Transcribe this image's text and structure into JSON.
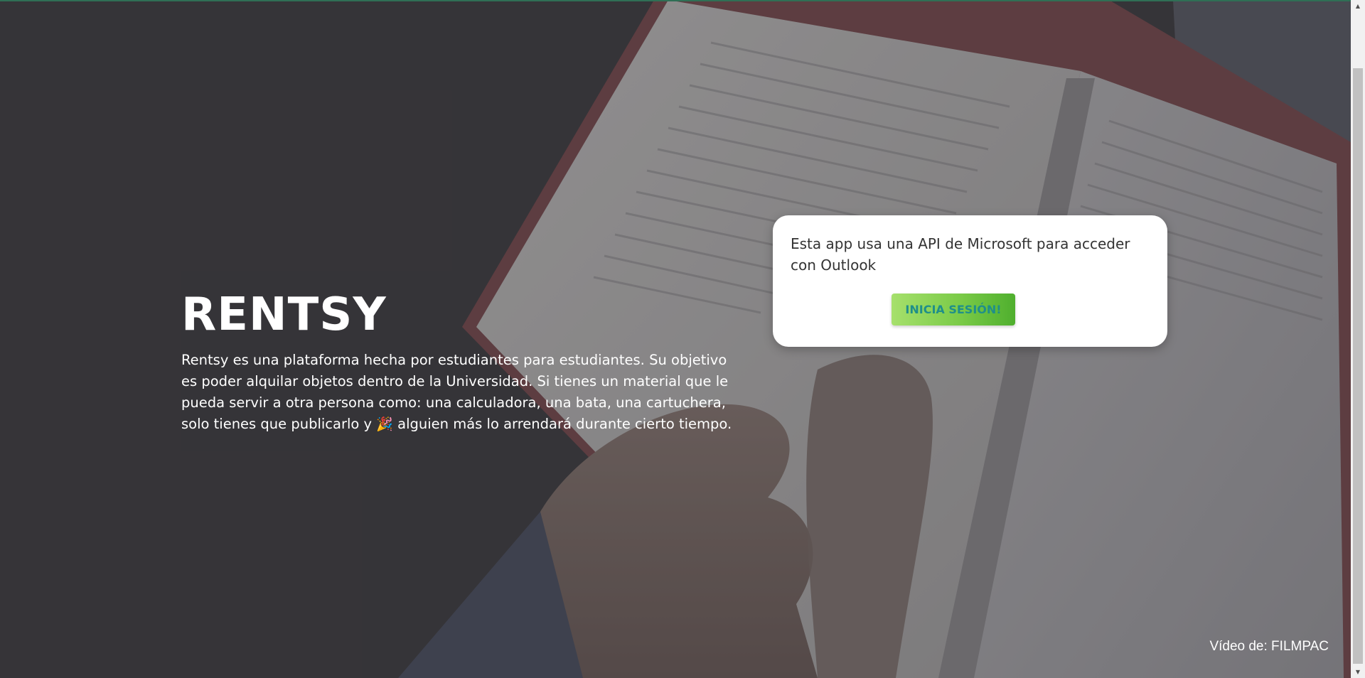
{
  "hero": {
    "title": "RENTSY",
    "description_before_emoji": "Rentsy es una plataforma hecha por estudiantes para estudiantes. Su objetivo es poder alquilar objetos dentro de la Universidad. Si tienes un material que le pueda servir a otra persona como: una calculadora, una bata, una cartuchera, solo tienes que publicarlo y ",
    "emoji": "🎉",
    "description_after_emoji": " alguien más lo arrendará durante cierto tiempo."
  },
  "login_card": {
    "text": "Esta app usa una API de Microsoft para acceder con Outlook",
    "button_label": "INICIA SESIÓN!"
  },
  "credit": {
    "text": "Vídeo de: FILMPAC"
  },
  "scrollbar": {
    "up_arrow": "▲",
    "down_arrow": "▼"
  },
  "colors": {
    "button_gradient_start": "#a6e06c",
    "button_gradient_end": "#4faf2e",
    "button_text": "#1f8f8a",
    "card_background": "#ffffff",
    "hero_text": "#ffffff"
  }
}
